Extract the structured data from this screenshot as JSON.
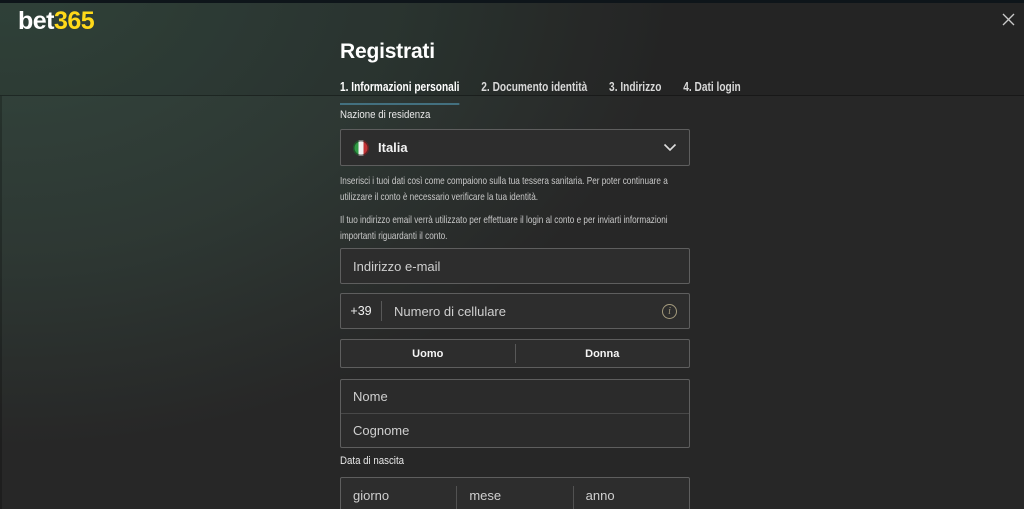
{
  "colors": {
    "brand_yellow": "#ffd919",
    "active_tab_underline": "#43707f",
    "page_background": "#272727",
    "field_border": "#5e5e5e",
    "info_icon": "#a49b7d",
    "flag_green": "#2f9a44",
    "flag_red": "#c23437"
  },
  "brand": {
    "name_prefix": "bet",
    "name_suffix": "365"
  },
  "header": {
    "title": "Registrati"
  },
  "tabs": [
    {
      "label": "1. Informazioni personali",
      "active": true
    },
    {
      "label": "2. Documento identità",
      "active": false
    },
    {
      "label": "3. Indirizzo",
      "active": false
    },
    {
      "label": "4. Dati login",
      "active": false
    }
  ],
  "form": {
    "country_label": "Nazione di residenza",
    "country_value": "Italia",
    "country_flag": "italy-flag",
    "paragraphs": [
      {
        "lines": [
          "Inserisci i tuoi dati così come compaiono sulla tua tessera sanitaria. Per poter continuare a",
          "utilizzare il conto è necessario verificare la tua identità."
        ]
      },
      {
        "lines": [
          "Il tuo indirizzo email verrà utilizzato per effettuare il login al conto e per inviarti informazioni",
          "importanti riguardanti il conto."
        ]
      }
    ],
    "email_placeholder": "Indirizzo e-mail",
    "phone_prefix": "+39",
    "phone_placeholder": "Numero di cellulare",
    "gender_male_label": "Uomo",
    "gender_female_label": "Donna",
    "first_name_placeholder": "Nome",
    "last_name_placeholder": "Cognome",
    "dob_label": "Data di nascita",
    "dob_day_placeholder": "giorno",
    "dob_month_placeholder": "mese",
    "dob_year_placeholder": "anno"
  },
  "icons": {
    "info": "i",
    "close": "close-x",
    "chevron": "chevron-down"
  }
}
